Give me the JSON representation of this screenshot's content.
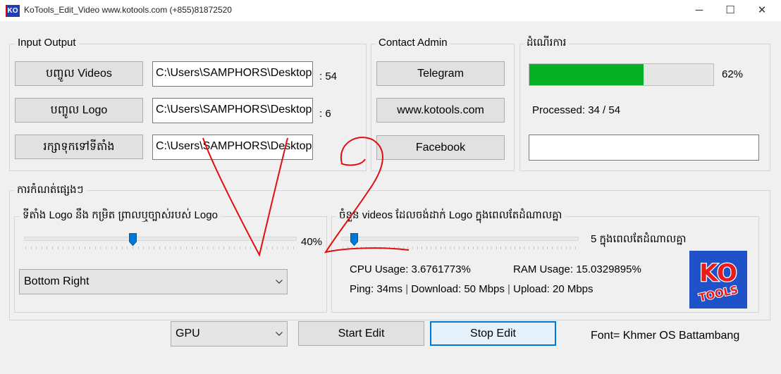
{
  "window": {
    "title": "KoTools_Edit_Video www.kotools.com (+855)81872520",
    "app_icon_text": "KO",
    "minimize": "─",
    "maximize": "☐",
    "close": "✕"
  },
  "input_output": {
    "label": "Input Output",
    "rows": [
      {
        "button": "បញ្ចូល Videos",
        "path": "C:\\Users\\SAMPHORS\\Desktop",
        "count": ": 54"
      },
      {
        "button": "បញ្ចូល Logo",
        "path": "C:\\Users\\SAMPHORS\\Desktop",
        "count": ": 6"
      },
      {
        "button": "រក្សាទុកទៅទីតាំង",
        "path": "C:\\Users\\SAMPHORS\\Desktop",
        "count": ""
      }
    ]
  },
  "contact": {
    "label": "Contact Admin",
    "buttons": [
      "Telegram",
      "www.kotools.com",
      "Facebook"
    ]
  },
  "progress": {
    "label": "ដំណើរការ",
    "percent_value": 62,
    "percent_text": "62%",
    "processed_text": "Processed: 34 / 54",
    "status_text": ""
  },
  "settings": {
    "label": "ការកំណត់ផ្សេងៗ",
    "logo_position": {
      "label": "ទីតាំង Logo នឹង កម្រិត ព្រាលឬច្បាស់របស់ Logo",
      "opacity_value": 40,
      "opacity_text": "40%",
      "position_selected": "Bottom Right"
    },
    "batch": {
      "label": "ចំនួន videos ដែលចង់ដាក់ Logo ក្នុងពេលតែដំណាលគ្នា",
      "slider_value": 5,
      "slider_text": "5 ក្នុងពេលតែដំណាលគ្នា",
      "cpu": "CPU Usage: 3.6761773%",
      "ram": "RAM Usage: 15.0329895%",
      "ping": "Ping: 34ms",
      "download": "Download: 50 Mbps",
      "upload": "Upload: 20 Mbps",
      "separator": "|",
      "logo_top": "KO",
      "logo_bottom": "TOOLS"
    }
  },
  "bottom": {
    "device_selected": "GPU",
    "start": "Start Edit",
    "stop": "Stop Edit",
    "font_note": "Font= Khmer OS Battambang"
  },
  "colors": {
    "progress_fill": "#06b025",
    "accent": "#0078d7",
    "handwriting": "#e01010",
    "logo_bg": "#1f52c9"
  }
}
